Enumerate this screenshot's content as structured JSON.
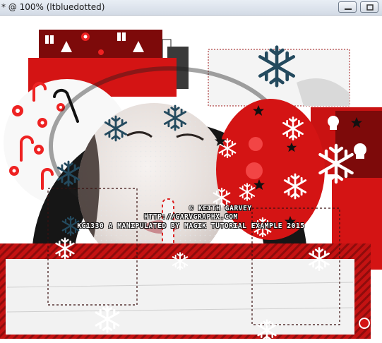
{
  "window": {
    "title": "* @ 100% (ltbluedotted)",
    "minimize_icon": "minimize-icon",
    "maximize_icon": "maximize-icon"
  },
  "canvas": {
    "watermark": {
      "line1": "© KEITH GARVEY",
      "line2": "HTTP://GARVGRAPHX.COM",
      "line3": "KG1330 A MANIPULATED BY MAGIK TUTORIAL EXAMPLE 2015"
    },
    "colors": {
      "red": "#d41414",
      "dark_red": "#8a0b0b",
      "black": "#151515",
      "snow_blue": "#244a5e",
      "white": "#ffffff",
      "marching_ants": "#3a1010"
    },
    "icons": [
      "snowflake-icon",
      "star-icon",
      "candy-cane-icon",
      "peppermint-icon",
      "skull-icon",
      "christmas-tree-icon",
      "gift-icon"
    ]
  }
}
